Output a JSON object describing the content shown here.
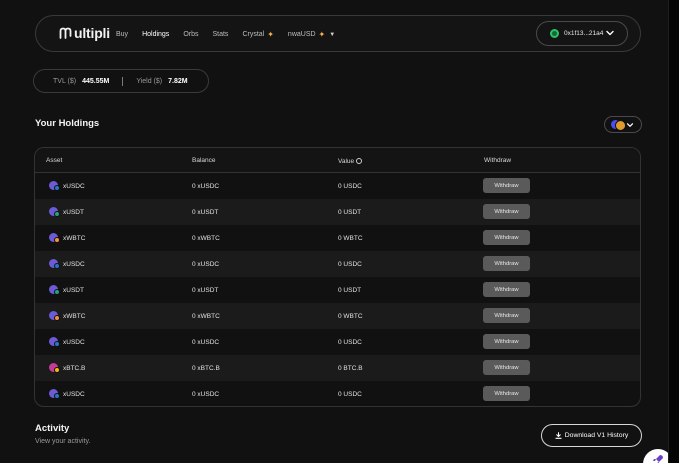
{
  "brand": {
    "logo_text": "ultipli"
  },
  "nav": {
    "items": [
      {
        "label": "Buy"
      },
      {
        "label": "Holdings"
      },
      {
        "label": "Orbs"
      },
      {
        "label": "Stats"
      },
      {
        "label": "Crystal"
      },
      {
        "label": "nwaUSD"
      }
    ],
    "active": "Holdings"
  },
  "wallet": {
    "address": "0x1f13...21a4"
  },
  "stats": {
    "tvl_label": "TVL ($)",
    "tvl_value": "445.55M",
    "yield_label": "Yield ($)",
    "yield_value": "7.82M"
  },
  "holdings": {
    "title": "Your Holdings",
    "columns": {
      "asset": "Asset",
      "balance": "Balance",
      "value": "Value",
      "withdraw": "Withdraw"
    },
    "withdraw_label": "Withdraw",
    "rows": [
      {
        "asset": "xUSDC",
        "balance": "0 xUSDC",
        "value": "0 USDC",
        "icon": "usdc-icon"
      },
      {
        "asset": "xUSDT",
        "balance": "0 xUSDT",
        "value": "0 USDT",
        "icon": "usdt-icon"
      },
      {
        "asset": "xWBTC",
        "balance": "0 xWBTC",
        "value": "0 WBTC",
        "icon": "wbtc-icon"
      },
      {
        "asset": "xUSDC",
        "balance": "0 xUSDC",
        "value": "0 USDC",
        "icon": "usdc-icon"
      },
      {
        "asset": "xUSDT",
        "balance": "0 xUSDT",
        "value": "0 USDT",
        "icon": "usdt-icon"
      },
      {
        "asset": "xWBTC",
        "balance": "0 xWBTC",
        "value": "0 WBTC",
        "icon": "wbtc-icon"
      },
      {
        "asset": "xUSDC",
        "balance": "0 xUSDC",
        "value": "0 USDC",
        "icon": "usdc-icon"
      },
      {
        "asset": "xBTC.B",
        "balance": "0 xBTC.B",
        "value": "0 BTC.B",
        "icon": "btcb-icon"
      },
      {
        "asset": "xUSDC",
        "balance": "0 xUSDC",
        "value": "0 USDC",
        "icon": "usdc-icon"
      }
    ]
  },
  "activity": {
    "title": "Activity",
    "subtitle": "View your activity.",
    "download_label": "Download V1 History"
  },
  "colors": {
    "background": "#111111",
    "accent_gold": "#f3b24b",
    "wallet_green": "#2fbf6a",
    "button_gray": "#5a5a5a"
  }
}
